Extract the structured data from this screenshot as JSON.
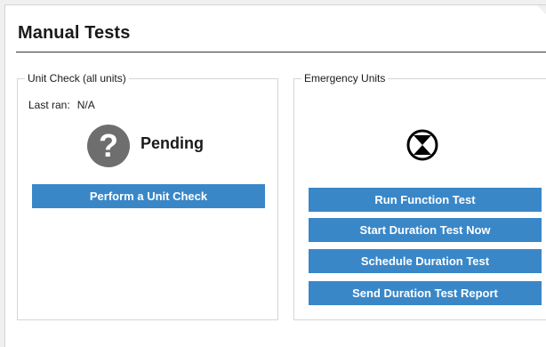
{
  "page": {
    "title": "Manual Tests"
  },
  "unit_check": {
    "legend": "Unit Check (all units)",
    "last_ran_label": "Last ran:",
    "last_ran_value": "N/A",
    "status_icon": "question-mark-icon",
    "status_text": "Pending",
    "button_label": "Perform a Unit Check"
  },
  "emergency_units": {
    "legend": "Emergency Units",
    "status_icon": "hourglass-circle-icon",
    "buttons": [
      {
        "label": "Run Function Test"
      },
      {
        "label": "Start Duration Test Now"
      },
      {
        "label": "Schedule Duration Test"
      },
      {
        "label": "Send Duration Test Report"
      }
    ]
  },
  "colors": {
    "button_bg": "#3a87c8",
    "button_text": "#ffffff",
    "status_icon_bg": "#6e6e6e"
  }
}
